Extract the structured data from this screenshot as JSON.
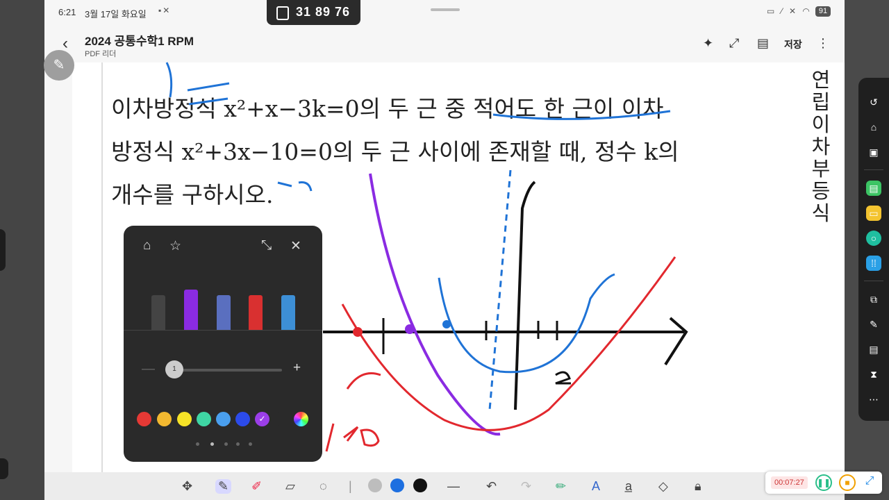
{
  "status": {
    "time": "6:21",
    "date": "3월 17일 화요일",
    "battery": "91"
  },
  "counter": {
    "value": "31 89 76"
  },
  "header": {
    "title": "2024 공통수학1 RPM",
    "subtitle": "PDF 리더",
    "save_label": "저장"
  },
  "question": {
    "line1": "이차방정식 x²+x−3k=0의 두 근 중 적어도 한 근이 이차",
    "line2": "방정식 x²+3x−10=0의 두 근 사이에 존재할 때, 정수 k의",
    "line3": "개수를 구하시오."
  },
  "side_heading": "연립이차부등식",
  "palette": {
    "size_value": "1",
    "colors": [
      "#e53935",
      "#f2b830",
      "#f5e227",
      "#3fd6a4",
      "#4a9fee",
      "#2c4bea",
      "#9b3ee8",
      "#2a2a2a"
    ],
    "selected_color": "#9b3ee8"
  },
  "bottom_colors": [
    "#bdbdbd",
    "#1d6fe0",
    "#111111"
  ],
  "recorder": {
    "elapsed": "00:07:27"
  },
  "ink_colors": {
    "red": "#e2282e",
    "purple": "#8a2be2",
    "blue": "#1f73d6",
    "black": "#111111"
  }
}
